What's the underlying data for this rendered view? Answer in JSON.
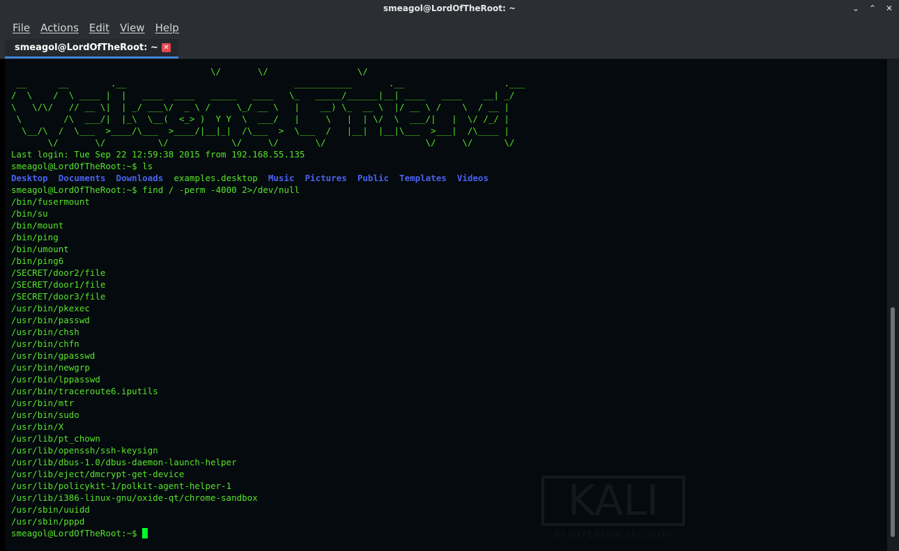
{
  "window": {
    "title": "smeagol@LordOfTheRoot: ~",
    "minimize": "⌄",
    "maximize": "⌃",
    "close": "✕"
  },
  "menu": [
    "File",
    "Actions",
    "Edit",
    "View",
    "Help"
  ],
  "tab": {
    "label": "smeagol@LordOfTheRoot: ~",
    "close": "✕"
  },
  "terminal": {
    "banner": [
      "                                      \\/       \\/                 \\/",
      " __      __        .__                                ___________       .__                   .___",
      "/  \\    /  \\ ____ |  |   ____  ____   _____   ____   \\_   _____/______|__| ____   ____    __| _/",
      "\\   \\/\\/   // __ \\|  | _/ ___\\/  _ \\ /     \\_/ __ \\   |    __) \\_  __ \\  |/ __ \\ /    \\  / __ |",
      " \\        /\\  ___/|  |_\\  \\__(  <_> )  Y Y  \\  ___/   |     \\   |  | \\/  \\  ___/|   |  \\/ /_/ |",
      "  \\__/\\  /  \\___  >____/\\___  >____/|__|_|  /\\___  >  \\___  /   |__|  |__|\\___  >___|  /\\____ |",
      "       \\/       \\/          \\/            \\/     \\/       \\/                   \\/     \\/      \\/"
    ],
    "last_login": "Last login: Tue Sep 22 12:59:38 2015 from 192.168.55.135",
    "prompt": "smeagol@LordOfTheRoot:~$ ",
    "cmd_ls": "ls",
    "ls_dirs_1": [
      "Desktop",
      "Documents",
      "Downloads"
    ],
    "ls_file": "examples.desktop",
    "ls_dirs_2": [
      "Music",
      "Pictures",
      "Public",
      "Templates",
      "Videos"
    ],
    "cmd_find": "find / -perm -4000 2>/dev/null",
    "find_results": [
      "/bin/fusermount",
      "/bin/su",
      "/bin/mount",
      "/bin/ping",
      "/bin/umount",
      "/bin/ping6",
      "/SECRET/door2/file",
      "/SECRET/door1/file",
      "/SECRET/door3/file",
      "/usr/bin/pkexec",
      "/usr/bin/passwd",
      "/usr/bin/chsh",
      "/usr/bin/chfn",
      "/usr/bin/gpasswd",
      "/usr/bin/newgrp",
      "/usr/bin/lppasswd",
      "/usr/bin/traceroute6.iputils",
      "/usr/bin/mtr",
      "/usr/bin/sudo",
      "/usr/bin/X",
      "/usr/lib/pt_chown",
      "/usr/lib/openssh/ssh-keysign",
      "/usr/lib/dbus-1.0/dbus-daemon-launch-helper",
      "/usr/lib/eject/dmcrypt-get-device",
      "/usr/lib/policykit-1/polkit-agent-helper-1",
      "/usr/lib/i386-linux-gnu/oxide-qt/chrome-sandbox",
      "/usr/sbin/uuidd",
      "/usr/sbin/pppd"
    ],
    "final_prompt": "smeagol@LordOfTheRoot:~$ ",
    "watermark": "KALI",
    "watermark_sub": "BY OFFENSIVE SECURITY"
  },
  "colors": {
    "text": "#58e32b",
    "directory": "#4a62f0",
    "cursor": "#00ff2a",
    "tab_indicator": "#3e86d8",
    "close_button": "#e5484d"
  }
}
